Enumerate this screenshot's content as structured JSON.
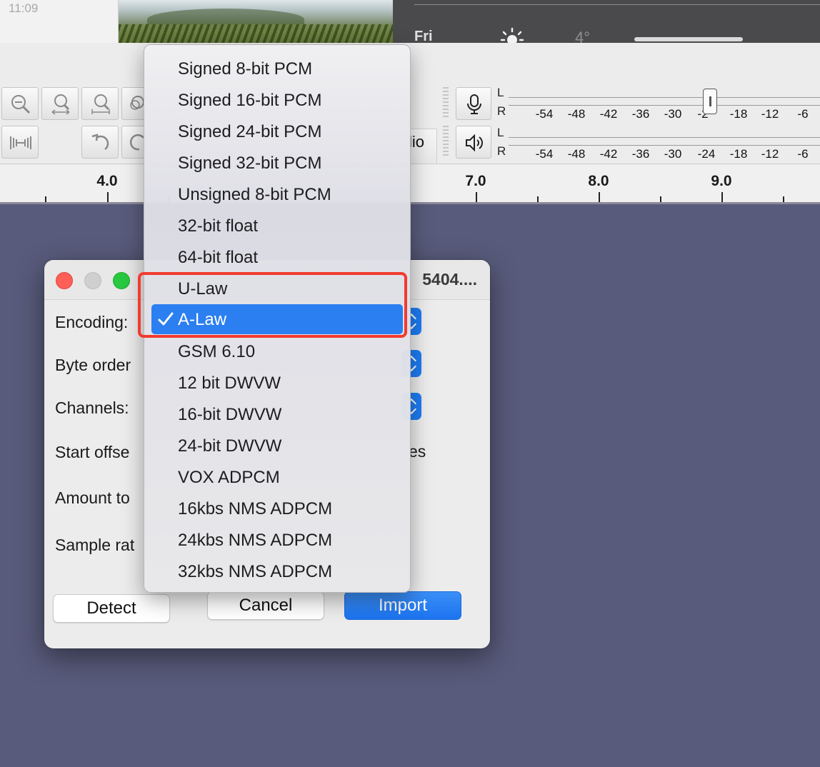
{
  "desktop": {
    "clock": "11:09",
    "weather_day": "Fri",
    "weather_temp": "4°",
    "weather_icon": "sun-icon"
  },
  "toolbar": {
    "partial_label": "lio",
    "meter_labels": {
      "left": "L",
      "right": "R"
    },
    "meter_ticks": [
      "-54",
      "-48",
      "-42",
      "-36",
      "-30",
      "-24",
      "-18",
      "-12",
      "-6"
    ],
    "record_meter_ticks": [
      "-54",
      "-48",
      "-42",
      "-36",
      "-30",
      "-2",
      "-18",
      "-12",
      "-6"
    ],
    "icons": [
      "zoom-out-icon",
      "zoom-fit-icon",
      "zoom-selection-icon",
      "zoom-toggle-icon",
      "trim-icon",
      "undo-icon",
      "redo-icon",
      "microphone-icon",
      "speaker-icon"
    ]
  },
  "ruler": {
    "labels": [
      "4.0",
      "7.0",
      "8.0",
      "9.0"
    ]
  },
  "dialog": {
    "title": "5404....",
    "fields": {
      "encoding": "Encoding:",
      "byte_order": "Byte order",
      "channels": "Channels:",
      "start_offset": "Start offse",
      "amount": "Amount to",
      "sample_rate": "Sample rat"
    },
    "start_offset_suffix": "es",
    "buttons": {
      "detect": "Detect",
      "cancel": "Cancel",
      "import": "Import"
    }
  },
  "encoding_menu": {
    "selected": "A-Law",
    "items": [
      "Signed 8-bit PCM",
      "Signed 16-bit PCM",
      "Signed 24-bit PCM",
      "Signed 32-bit PCM",
      "Unsigned 8-bit PCM",
      "32-bit float",
      "64-bit float",
      "U-Law",
      "A-Law",
      "GSM 6.10",
      "12 bit DWVW",
      "16-bit DWVW",
      "24-bit DWVW",
      "VOX ADPCM",
      "16kbs NMS ADPCM",
      "24kbs NMS ADPCM",
      "32kbs NMS ADPCM"
    ]
  },
  "colors": {
    "accent": "#2b7ff0",
    "annotation": "#f23a2e",
    "background": "#585b7b"
  }
}
